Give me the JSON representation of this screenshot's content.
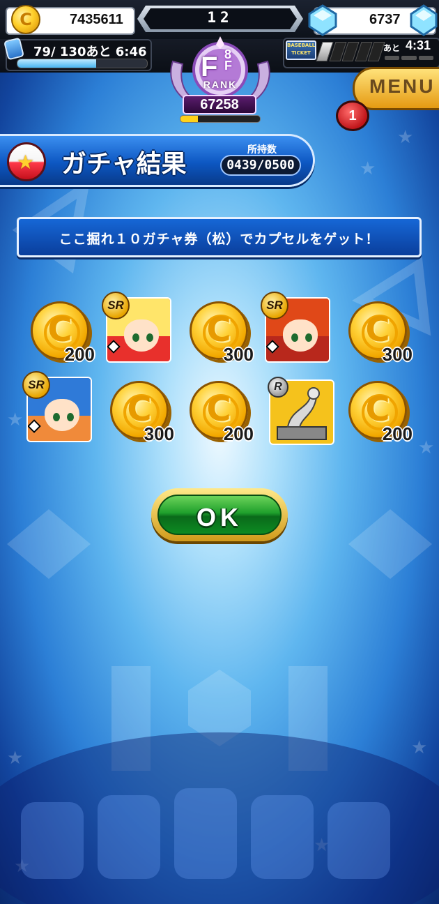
{
  "hud": {
    "coins": "7435611",
    "level": "12",
    "gems": "6737",
    "stamina_text": "79/ 130あと  6:46",
    "stamina_fraction": 0.61,
    "ticket_ato": "あと",
    "ticket_timer": "4:31",
    "ticket_label": "BASEBALL TICKET",
    "ticket_filled": 1,
    "ticket_total": 5
  },
  "rank": {
    "letter": "F",
    "sub": "8",
    "sub_letter": "F",
    "label": "RANK",
    "points": "67258",
    "fraction": 0.22
  },
  "menu": {
    "label": "MENU",
    "badge": "1"
  },
  "header": {
    "title": "ガチャ結果",
    "own_label": "所持数",
    "own_value": "0439/0500"
  },
  "message": "ここ掘れ１０ガチャ券（松）でカプセルをゲット！",
  "results": [
    {
      "type": "coin",
      "amount": "200"
    },
    {
      "type": "card",
      "rarity": "SR",
      "hair": "#ffe56a",
      "bg": "#e8302c"
    },
    {
      "type": "coin",
      "amount": "300"
    },
    {
      "type": "card",
      "rarity": "SR",
      "hair": "#e04818",
      "bg": "#b8281c"
    },
    {
      "type": "coin",
      "amount": "300"
    },
    {
      "type": "card",
      "rarity": "SR",
      "hair": "#2f7ad8",
      "bg": "#f08a3a"
    },
    {
      "type": "coin",
      "amount": "300"
    },
    {
      "type": "coin",
      "amount": "200"
    },
    {
      "type": "item",
      "rarity": "R",
      "bg": "#f5c21c"
    },
    {
      "type": "coin",
      "amount": "200"
    }
  ],
  "ok_label": "OK",
  "colors": {
    "accent_gold": "#ffd23a",
    "button_green": "#1fa02c",
    "banner_blue": "#0a3e9c"
  }
}
